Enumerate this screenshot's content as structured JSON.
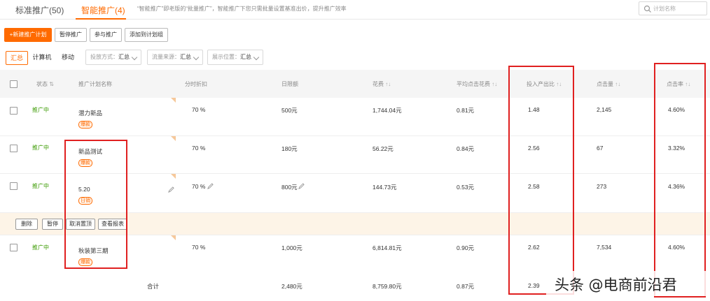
{
  "top_tabs": {
    "standard": "标准推广(50)",
    "smart": "智能推广(4)",
    "hint": "“智能推广”即老版的“批量推广”，智能推广下您只需批量设置基准出价，提升推广效率",
    "search_placeholder": "计划名称"
  },
  "toolbar": {
    "new_plan": "+新建推广计划",
    "pause": "暂停推广",
    "join": "参与推广",
    "add_to_group": "添加到计划组"
  },
  "filters": {
    "tabs": [
      "汇总",
      "计算机",
      "移动"
    ],
    "delivery_label": "投放方式：",
    "delivery_value": "汇总",
    "traffic_label": "流量来源：",
    "traffic_value": "汇总",
    "position_label": "展示位置：",
    "position_value": "汇总"
  },
  "table": {
    "headers": {
      "status": "状态",
      "name": "推广计划名称",
      "time_discount": "分时折扣",
      "daily_budget": "日限额",
      "cost": "花费",
      "avg_cpc": "平均点击花费",
      "roi": "投入产出比",
      "clicks": "点击量",
      "ctr": "点击率"
    },
    "sort_glyph": "↑↓",
    "rows": [
      {
        "status": "推广中",
        "name": "潜力新品",
        "tag": "爆款",
        "discount": "70 %",
        "budget": "500元",
        "cost": "1,744.04元",
        "cpc": "0.81元",
        "roi": "1.48",
        "clicks": "2,145",
        "ctr": "4.60%"
      },
      {
        "status": "推广中",
        "name": "新品测试",
        "tag": "爆款",
        "discount": "70 %",
        "budget": "180元",
        "cost": "56.22元",
        "cpc": "0.84元",
        "roi": "2.56",
        "clicks": "67",
        "ctr": "3.32%"
      },
      {
        "status": "推广中",
        "name": "5.20",
        "tag": "日销",
        "discount": "70 %",
        "budget": "800元",
        "cost": "144.73元",
        "cpc": "0.53元",
        "roi": "2.58",
        "clicks": "273",
        "ctr": "4.36%"
      },
      {
        "status": "推广中",
        "name": "秋装第三期",
        "tag": "爆款",
        "discount": "70 %",
        "budget": "1,000元",
        "cost": "6,814.81元",
        "cpc": "0.90元",
        "roi": "2.62",
        "clicks": "7,534",
        "ctr": "4.60%"
      }
    ],
    "total": {
      "label": "合计",
      "budget": "2,480元",
      "cost": "8,759.80元",
      "cpc": "0.87元",
      "roi": "2.39"
    }
  },
  "actions": {
    "delete": "删除",
    "pause": "暂停",
    "unpin": "取消置顶",
    "report": "查看报表"
  },
  "watermark": "头条 @电商前沿君",
  "colors": {
    "accent": "#ff6a00",
    "status_green": "#3a9a00",
    "highlight_box": "#e02020"
  }
}
